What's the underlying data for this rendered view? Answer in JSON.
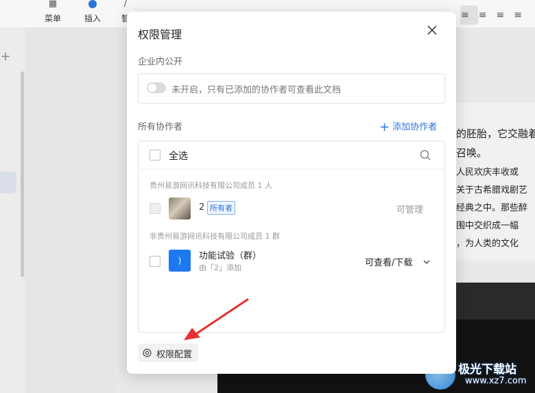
{
  "toolbar": {
    "menu_label": "菜单",
    "insert_label": "插入",
    "partial_label": "智"
  },
  "document": {
    "lines": [
      "的胚胎，它交融着",
      "召唤。",
      "人民欢庆丰收或",
      "关于古希腊戏剧艺",
      "经典之中。那些醉",
      "围中交织成一幅",
      "，为人类的文化"
    ]
  },
  "dialog": {
    "title": "权限管理",
    "close_icon": "close-icon",
    "public_section_label": "企业内公开",
    "public_toggle_text": "未开启，只有已添加的协作者可查看此文档",
    "collaborators_label": "所有协作者",
    "add_collaborator": "添加协作者",
    "select_all": "全选",
    "groups": [
      {
        "label": "贵州易游网讯科技有限公司成员 1 人"
      },
      {
        "label": "非贵州易游网讯科技有限公司成员 1 群"
      }
    ],
    "members": [
      {
        "name": "2",
        "badge": "所有者",
        "permission": "可管理"
      },
      {
        "name": "功能试验（群）",
        "subtitle": "由「2」添加",
        "avatar_text": ")",
        "permission": "可查看/下载"
      }
    ],
    "config_button": "权限配置"
  },
  "watermark": {
    "title": "极光下载站",
    "url": "www.xz7.com"
  },
  "colors": {
    "accent": "#2b74d9",
    "arrow": "#e53030",
    "avatar_blue": "#1e78f0"
  }
}
